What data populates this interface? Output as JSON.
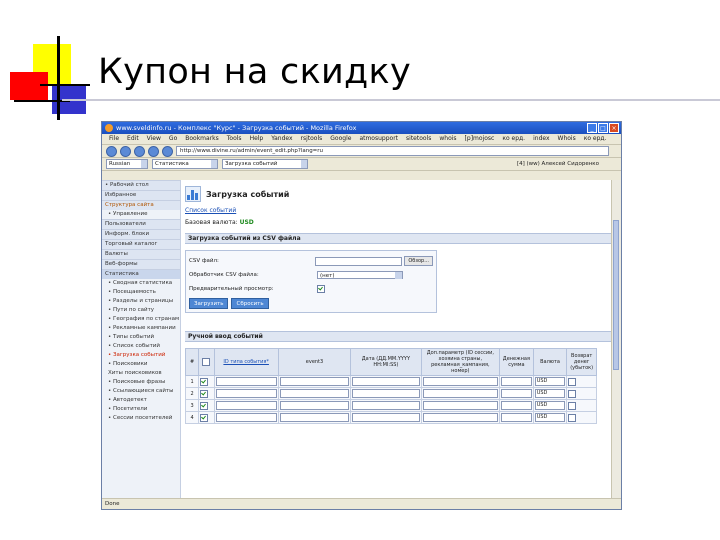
{
  "slide": {
    "title": "Купон на скидку"
  },
  "browser": {
    "window_title": "www.sveldinfo.ru - Комплекс \"Курс\" - Загрузка событий - Mozilla Firefox",
    "menu": [
      "File",
      "Edit",
      "View",
      "Go",
      "Bookmarks",
      "Tools",
      "Help"
    ],
    "toolbar_links": [
      "Yandex",
      "rsjtools",
      "Google",
      "atmosupport",
      "sitetools",
      "whois",
      "[p]mojosc",
      "ко ерд.",
      "index",
      "Whois",
      "ко ерд."
    ],
    "url": "http://www.divine.ru/admin/event_edit.php?lang=ru",
    "status": "Done"
  },
  "appbar": {
    "language": "Russian",
    "section": "Статистика",
    "page": "Загрузка событий",
    "user": "[4] (ww) Алексей Сидоренко"
  },
  "sidebar": {
    "items": [
      {
        "type": "cat",
        "label": "• Рабочий стол"
      },
      {
        "type": "cat",
        "label": "Избранное"
      },
      {
        "type": "cat",
        "label": "Структура сайта"
      },
      {
        "type": "sub",
        "label": "• Управление"
      },
      {
        "type": "cat",
        "label": "Пользователи"
      },
      {
        "type": "cat",
        "label": "Информ. блоки"
      },
      {
        "type": "cat",
        "label": "Торговый каталог"
      },
      {
        "type": "cat",
        "label": "Валюты"
      },
      {
        "type": "cat",
        "label": "Веб-формы"
      },
      {
        "type": "cat",
        "label": "Статистика",
        "active": true
      },
      {
        "type": "sub",
        "label": "• Сводная статистика"
      },
      {
        "type": "sub",
        "label": "• Посещаемость"
      },
      {
        "type": "sub",
        "label": "• Разделы и страницы"
      },
      {
        "type": "sub",
        "label": "• Пути по сайту"
      },
      {
        "type": "sub",
        "label": "• География по странам"
      },
      {
        "type": "sub",
        "label": "• Рекламные кампании"
      },
      {
        "type": "sub",
        "label": "• Типы событий"
      },
      {
        "type": "sub",
        "label": "• Список событий"
      },
      {
        "type": "sub",
        "label": "• Загрузка событий",
        "active": true
      },
      {
        "type": "sub",
        "label": "• Поисковики"
      },
      {
        "type": "sub",
        "label": "Хиты поисковиков"
      },
      {
        "type": "sub",
        "label": "• Поисковые фразы"
      },
      {
        "type": "sub",
        "label": "• Ссылающиеся сайты"
      },
      {
        "type": "sub",
        "label": "• Автодетект"
      },
      {
        "type": "sub",
        "label": "• Посетители"
      },
      {
        "type": "sub",
        "label": "• Сессии посетителей"
      }
    ]
  },
  "main": {
    "title": "Загрузка событий",
    "link_label": "Список событий",
    "currency_label": "Базовая валюта:",
    "currency_value": "USD",
    "csv_section": "Загрузка событий из CSV файла",
    "csv_form": {
      "file_label": "CSV файл:",
      "browse_label": "Обзор...",
      "handler_label": "Обработчик CSV файла:",
      "handler_value": "(нет)",
      "preview_label": "Предварительный просмотр:",
      "preview_checked": true
    },
    "buttons": {
      "upload": "Загрузить",
      "reset": "Сбросить"
    },
    "manual_section": "Ручной ввод событий",
    "table": {
      "headers": [
        "#",
        "",
        "ID типа события*",
        "event3",
        "Дата (ДД.ММ.YYYY HH:MI:SS)",
        "Доп.параметр (ID сессии, хозяина страны, рекламная_кампания, номер)",
        "Денежная сумма",
        "Валюта",
        "Возврат денег (убыток)"
      ],
      "rows": [
        {
          "num": "1",
          "currency": "USD"
        },
        {
          "num": "2",
          "currency": "USD"
        },
        {
          "num": "3",
          "currency": "USD"
        },
        {
          "num": "4",
          "currency": "USD"
        }
      ]
    }
  },
  "colors": {
    "accent_green": "#1e8a1e",
    "link_blue": "#1a4fb5",
    "button_blue": "#4e87d4"
  }
}
